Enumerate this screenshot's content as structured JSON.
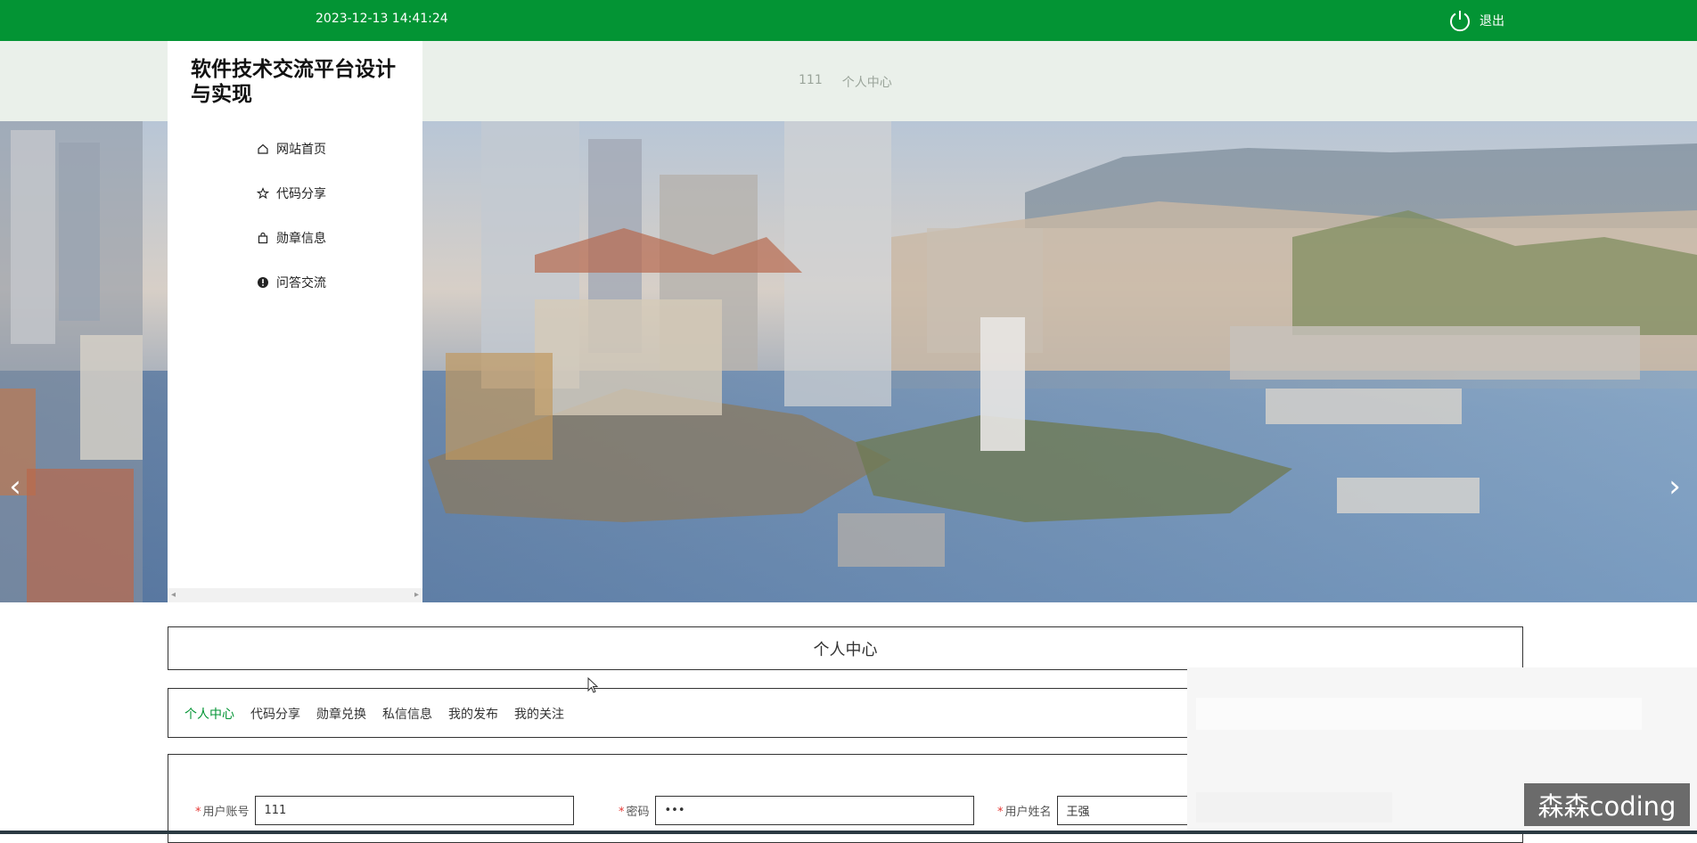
{
  "header": {
    "datetime": "2023-12-13 14:41:24",
    "logout_label": "退出",
    "logout_icon": "power-icon",
    "bg_color": "#039434"
  },
  "nav": {
    "links": [
      {
        "label": "111"
      },
      {
        "label": "个人中心"
      }
    ]
  },
  "sidebar": {
    "title": "软件技术交流平台设计与实现",
    "items": [
      {
        "label": "网站首页",
        "icon": "home-icon"
      },
      {
        "label": "代码分享",
        "icon": "star-icon"
      },
      {
        "label": "勋章信息",
        "icon": "bag-icon"
      },
      {
        "label": "问答交流",
        "icon": "exclamation-circle-icon"
      }
    ]
  },
  "banner": {
    "prev_arrow": "‹",
    "next_arrow": "›",
    "slide_count": 1
  },
  "section": {
    "title": "个人中心"
  },
  "tabs": [
    {
      "label": "个人中心",
      "active": true
    },
    {
      "label": "代码分享",
      "active": false
    },
    {
      "label": "勋章兑换",
      "active": false
    },
    {
      "label": "私信信息",
      "active": false
    },
    {
      "label": "我的发布",
      "active": false
    },
    {
      "label": "我的关注",
      "active": false
    }
  ],
  "form": {
    "fields": [
      {
        "label": "用户账号",
        "value": "111",
        "required": true
      },
      {
        "label": "密码",
        "value": "•••",
        "required": true
      },
      {
        "label": "用户姓名",
        "value": "王强",
        "required": true
      }
    ]
  },
  "watermark": {
    "text": "森森coding"
  }
}
